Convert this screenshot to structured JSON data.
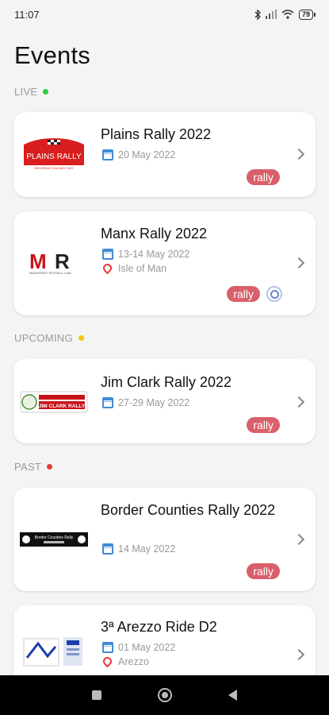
{
  "status_bar": {
    "time": "11:07",
    "battery": "79"
  },
  "page": {
    "title": "Events"
  },
  "sections": {
    "live": {
      "label": "LIVE",
      "dot_color": "#2ecc40"
    },
    "upcoming": {
      "label": "UPCOMING",
      "dot_color": "#f5c518"
    },
    "past": {
      "label": "PAST",
      "dot_color": "#e53935"
    }
  },
  "events": {
    "plains": {
      "title": "Plains Rally 2022",
      "date": "20 May 2022",
      "tag": "rally",
      "logo_text": "PLAINS RALLY",
      "logo_sub": "SATURDAY 21st MAY 2022"
    },
    "manx": {
      "title": "Manx Rally 2022",
      "date": "13-14 May 2022",
      "location": "Isle of Man",
      "tag": "rally",
      "logo_text": "MR",
      "logo_sub": "MANXPRINT ROTHELL.LAW"
    },
    "jimclark": {
      "title": "Jim Clark Rally 2022",
      "date": "27-29 May 2022",
      "tag": "rally",
      "logo_text": "JIM CLARK RALLY"
    },
    "border": {
      "title": "Border Counties Rally 2022",
      "date": "14 May 2022",
      "tag": "rally",
      "logo_text": "Border Counties Rally"
    },
    "arezzo": {
      "title": "3ª Arezzo Ride D2",
      "date": "01 May 2022",
      "location": "Arezzo"
    }
  },
  "colors": {
    "tag": "#d9606a",
    "calendar_icon": "#3f8bd6",
    "pin_icon": "#e53935"
  }
}
